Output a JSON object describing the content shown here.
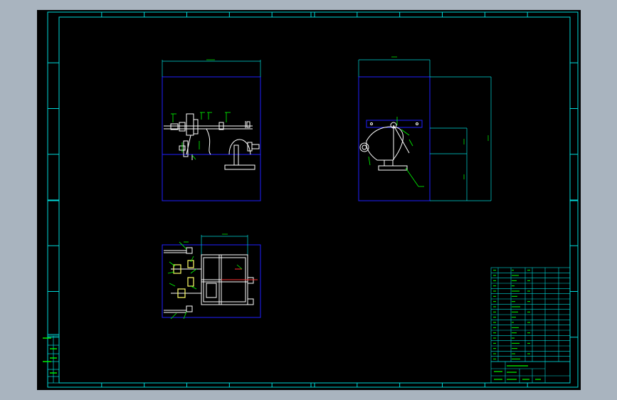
{
  "colors": {
    "window_bg": "#a9b4bf",
    "sheet_bg": "#000000",
    "frame": "#00d8d8",
    "part": "#2020ff",
    "line_white": "#ffffff",
    "label_green": "#00ff00",
    "dimension": "#00c0c0",
    "highlight_yellow": "#ffff66",
    "section_red": "#ff3333"
  },
  "drawing": {
    "frame_border_numbers_top": [
      "1",
      "2",
      "3",
      "4",
      "5",
      "6",
      "7",
      "8",
      "9",
      "10",
      "11",
      "12"
    ],
    "frame_border_letters_side": [
      "A",
      "B",
      "C",
      "D",
      "E",
      "F",
      "G",
      "H"
    ],
    "views": [
      "front-view",
      "side-view",
      "top-view"
    ],
    "title_block": {
      "has_parts_list": true,
      "rows": 18
    }
  }
}
